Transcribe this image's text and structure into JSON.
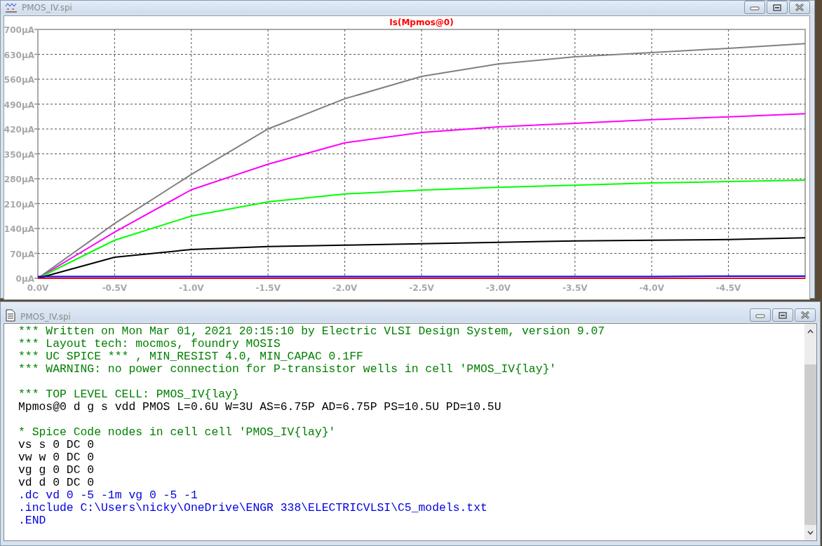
{
  "plot_window": {
    "title": "PMOS_IV.spi",
    "chart_data": {
      "type": "line",
      "title": "Is(Mpmos@0)",
      "x": [
        0,
        -0.5,
        -1,
        -1.5,
        -2,
        -2.5,
        -3,
        -3.5,
        -4,
        -4.5,
        -5
      ],
      "series": [
        {
          "color": "#808080",
          "values": [
            0,
            154,
            292,
            420,
            505,
            568,
            603,
            623,
            635,
            647,
            660
          ]
        },
        {
          "color": "#ff00ff",
          "values": [
            0,
            130,
            249,
            321,
            381,
            410,
            426,
            436,
            446,
            454,
            463
          ]
        },
        {
          "color": "#00ff00",
          "values": [
            0,
            107,
            175,
            215,
            237,
            248,
            256,
            262,
            268,
            272,
            276
          ]
        },
        {
          "color": "#000000",
          "values": [
            0,
            59,
            81,
            89,
            93,
            97,
            101,
            105,
            107,
            109,
            114
          ]
        },
        {
          "color": "#ff0000",
          "values": [
            0,
            0,
            0,
            0,
            0,
            0,
            0,
            0,
            0,
            0,
            0
          ]
        },
        {
          "color": "#0000ff",
          "values": [
            5,
            5,
            5,
            5,
            5,
            5,
            5,
            5,
            5,
            6,
            6
          ]
        }
      ],
      "grid": true,
      "xlim": [
        0,
        -5
      ],
      "ylim": [
        0,
        700
      ],
      "xticks": [
        {
          "value": 0,
          "label": "0.0V"
        },
        {
          "value": -0.5,
          "label": "-0.5V"
        },
        {
          "value": -1,
          "label": "-1.0V"
        },
        {
          "value": -1.5,
          "label": "-1.5V"
        },
        {
          "value": -2,
          "label": "-2.0V"
        },
        {
          "value": -2.5,
          "label": "-2.5V"
        },
        {
          "value": -3,
          "label": "-3.0V"
        },
        {
          "value": -3.5,
          "label": "-3.5V"
        },
        {
          "value": -4,
          "label": "-4.0V"
        },
        {
          "value": -4.5,
          "label": "-4.5V"
        }
      ],
      "yticks": [
        {
          "value": 0,
          "label": "0µA"
        },
        {
          "value": 70,
          "label": "70µA"
        },
        {
          "value": 140,
          "label": "140µA"
        },
        {
          "value": 210,
          "label": "210µA"
        },
        {
          "value": 280,
          "label": "280µA"
        },
        {
          "value": 350,
          "label": "350µA"
        },
        {
          "value": 420,
          "label": "420µA"
        },
        {
          "value": 490,
          "label": "490µA"
        },
        {
          "value": 560,
          "label": "560µA"
        },
        {
          "value": 630,
          "label": "630µA"
        },
        {
          "value": 700,
          "label": "700µA"
        }
      ]
    }
  },
  "netlist_window": {
    "title": "PMOS_IV.spi",
    "lines": [
      {
        "kind": "comment",
        "text": "*** Written on Mon Mar 01, 2021 20:15:10 by Electric VLSI Design System, version 9.07"
      },
      {
        "kind": "comment",
        "text": "*** Layout tech: mocmos, foundry MOSIS"
      },
      {
        "kind": "comment",
        "text": "*** UC SPICE *** , MIN_RESIST 4.0, MIN_CAPAC 0.1FF"
      },
      {
        "kind": "comment",
        "text": "*** WARNING: no power connection for P-transistor wells in cell 'PMOS_IV{lay}'"
      },
      {
        "kind": "blank"
      },
      {
        "kind": "comment",
        "text": "*** TOP LEVEL CELL: PMOS_IV{lay}"
      },
      {
        "kind": "element",
        "text": "Mpmos@0 d g s vdd PMOS L=0.6U W=3U AS=6.75P AD=6.75P PS=10.5U PD=10.5U"
      },
      {
        "kind": "blank"
      },
      {
        "kind": "comment",
        "text": "* Spice Code nodes in cell cell 'PMOS_IV{lay}'"
      },
      {
        "kind": "element",
        "text": "vs s 0 DC 0"
      },
      {
        "kind": "element",
        "text": "vw w 0 DC 0"
      },
      {
        "kind": "element",
        "text": "vg g 0 DC 0"
      },
      {
        "kind": "element",
        "text": "vd d 0 DC 0"
      },
      {
        "kind": "command",
        "text": ".dc vd 0 -5 -1m vg 0 -5 -1"
      },
      {
        "kind": "command",
        "text": ".include C:\\Users\\nicky\\OneDrive\\ENGR 338\\ELECTRICVLSI\\C5_models.txt"
      },
      {
        "kind": "command",
        "text": ".END"
      }
    ]
  }
}
